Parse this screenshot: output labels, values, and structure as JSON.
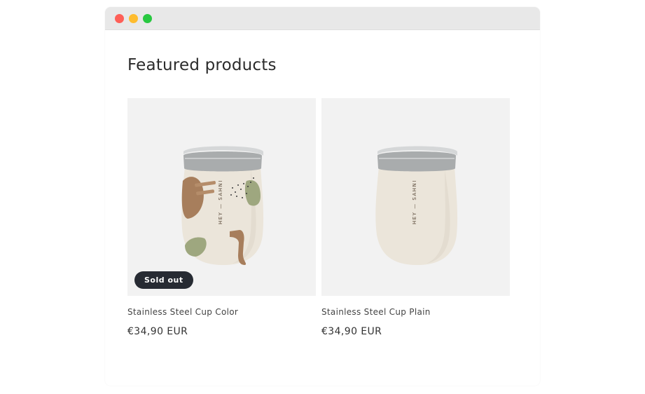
{
  "window": {
    "controls": [
      "close",
      "minimize",
      "maximize"
    ]
  },
  "section": {
    "title": "Featured products"
  },
  "products": [
    {
      "name": "Stainless Steel Cup Color",
      "price": "€34,90 EUR",
      "badge": "Sold out",
      "cup_text": "HEY — SAHNI",
      "variant": "color"
    },
    {
      "name": "Stainless Steel Cup Plain",
      "price": "€34,90 EUR",
      "cup_text": "HEY — SAHNI",
      "variant": "plain"
    }
  ],
  "colors": {
    "titlebar": "#e8e8e8",
    "close": "#fe5f57",
    "minimize": "#febc2e",
    "maximize": "#28c840",
    "media_bg": "#f2f2f2",
    "badge_bg": "#272b33",
    "cup_body": "#ebe5da",
    "cup_lid": "#a9acad",
    "shape_brown": "#a77e5c",
    "shape_green": "#9ea77f"
  }
}
